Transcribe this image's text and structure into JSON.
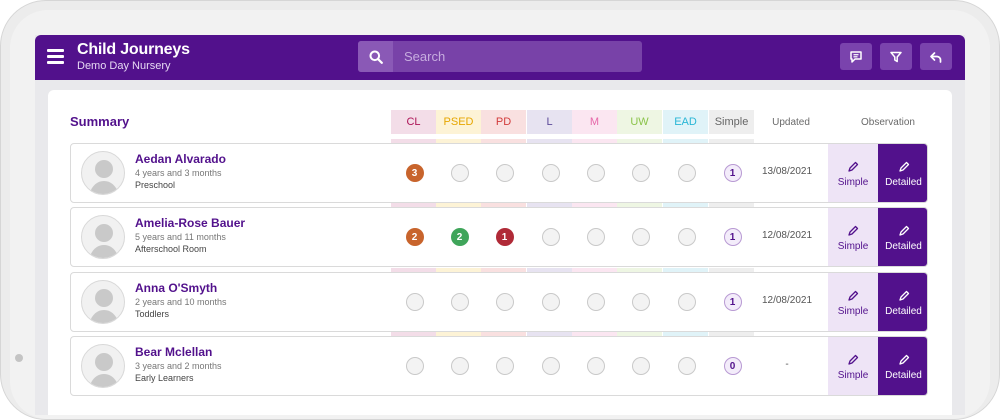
{
  "header": {
    "title": "Child Journeys",
    "subtitle": "Demo Day Nursery",
    "search_placeholder": "Search",
    "icons": [
      "menu-icon",
      "search-icon",
      "chat-icon",
      "filter-icon",
      "back-icon"
    ]
  },
  "summary": {
    "title": "Summary",
    "areas": [
      {
        "label": "CL",
        "color": "#ad1457",
        "tint": "#f3dde8"
      },
      {
        "label": "PSED",
        "color": "#e6a600",
        "tint": "#fdf3d6"
      },
      {
        "label": "PD",
        "color": "#d23b3b",
        "tint": "#f9e0e0"
      },
      {
        "label": "L",
        "color": "#5c4a9a",
        "tint": "#e7e3f1"
      },
      {
        "label": "M",
        "color": "#e667a9",
        "tint": "#fbe6f1"
      },
      {
        "label": "UW",
        "color": "#8bc34a",
        "tint": "#eef6e3"
      },
      {
        "label": "EAD",
        "color": "#29b6d6",
        "tint": "#e0f3f8"
      },
      {
        "label": "Simple",
        "color": "#666666",
        "tint": "#eeeeee"
      }
    ],
    "updated_label": "Updated",
    "observation_label": "Observation"
  },
  "children": [
    {
      "name": "Aedan Alvarado",
      "age": "4 years and 3 months",
      "room": "Preschool",
      "updated": "13/08/2021",
      "simple_count": "1",
      "counts": [
        "3",
        "",
        "",
        "",
        "",
        "",
        ""
      ]
    },
    {
      "name": "Amelia-Rose Bauer",
      "age": "5 years and 11 months",
      "room": "Afterschool Room",
      "updated": "12/08/2021",
      "simple_count": "1",
      "counts": [
        "2",
        "2",
        "1",
        "",
        "",
        "",
        ""
      ]
    },
    {
      "name": "Anna O'Smyth",
      "age": "2 years and 10 months",
      "room": "Toddlers",
      "updated": "12/08/2021",
      "simple_count": "1",
      "counts": [
        "",
        "",
        "",
        "",
        "",
        "",
        ""
      ]
    },
    {
      "name": "Bear Mclellan",
      "age": "3 years and 2 months",
      "room": "Early Learners",
      "updated": "-",
      "simple_count": "0",
      "counts": [
        "",
        "",
        "",
        "",
        "",
        "",
        ""
      ]
    }
  ],
  "badge_colors": {
    "orange": "#c8642c",
    "green": "#3fa55a",
    "red": "#b02a37"
  },
  "badges": [
    [
      "orange",
      "",
      "",
      "",
      "",
      "",
      ""
    ],
    [
      "orange",
      "green",
      "red",
      "",
      "",
      "",
      ""
    ],
    [
      "",
      "",
      "",
      "",
      "",
      "",
      ""
    ],
    [
      "",
      "",
      "",
      "",
      "",
      "",
      ""
    ]
  ],
  "buttons": {
    "simple": "Simple",
    "detailed": "Detailed"
  },
  "theme": {
    "primary": "#52118c"
  }
}
